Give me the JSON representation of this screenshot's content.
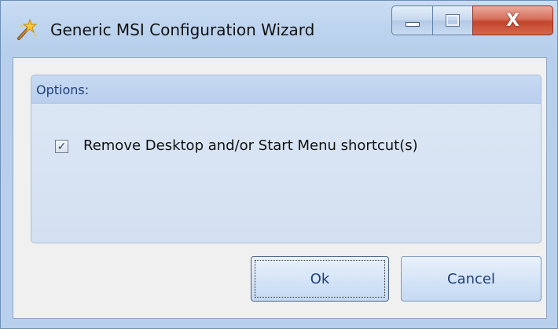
{
  "window": {
    "title": "Generic MSI Configuration Wizard",
    "icon": "wizard-wand-icon",
    "caption_buttons": {
      "minimize_icon": "minimize-icon",
      "maximize_icon": "maximize-icon",
      "close_glyph": "X"
    },
    "colors": {
      "frame": "#b9d0ec",
      "close_button": "#c3452c",
      "panel_title": "#1f3f77"
    }
  },
  "options": {
    "title": "Options:",
    "checkbox": {
      "checked": true,
      "mark": "✓",
      "label": "Remove Desktop and/or Start Menu shortcut(s)"
    }
  },
  "buttons": {
    "ok_label": "Ok",
    "cancel_label": "Cancel"
  }
}
